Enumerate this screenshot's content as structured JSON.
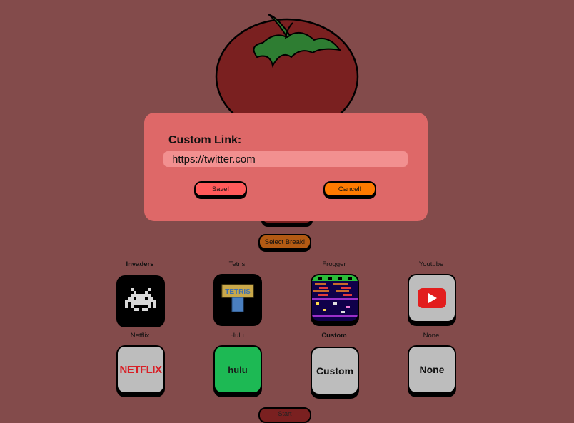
{
  "main": {
    "select_break_label": "Select Break!",
    "start_label": "Start"
  },
  "games": [
    {
      "label": "Invaders",
      "selected": true,
      "icon": "space-invader-icon"
    },
    {
      "label": "Tetris",
      "selected": false,
      "icon": "tetris-logo-icon"
    },
    {
      "label": "Frogger",
      "selected": false,
      "icon": "frogger-screen-icon"
    },
    {
      "label": "Youtube",
      "selected": false,
      "icon": "youtube-play-icon"
    },
    {
      "label": "Netflix",
      "selected": false,
      "icon": "netflix-logo-icon",
      "tile_text": "NETFLIX"
    },
    {
      "label": "Hulu",
      "selected": false,
      "icon": "hulu-logo-icon",
      "tile_text": "hulu"
    },
    {
      "label": "Custom",
      "selected": true,
      "icon": "custom-tile",
      "tile_text": "Custom"
    },
    {
      "label": "None",
      "selected": false,
      "icon": "none-tile",
      "tile_text": "None"
    }
  ],
  "modal": {
    "title": "Custom Link:",
    "input_value": "https://twitter.com",
    "save_label": "Save!",
    "cancel_label": "Cancel!"
  },
  "colors": {
    "background": "#834b4b",
    "tomato": "#7a2020",
    "leaves": "#2e7d32",
    "modal": "#de6868",
    "save": "#ff5a5a",
    "cancel": "#ff7a00",
    "select_break": "#b35a13",
    "hulu": "#1db954",
    "youtube": "#e21d1d",
    "netflix": "#d81f26"
  }
}
